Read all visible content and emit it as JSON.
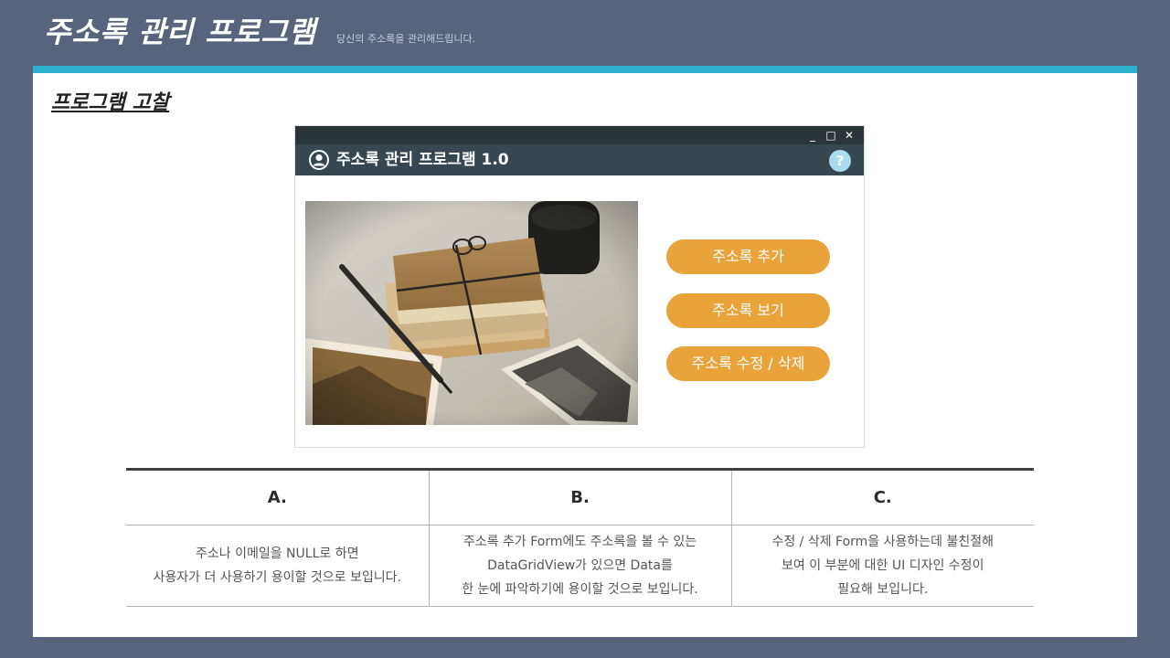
{
  "header": {
    "title": "주소록 관리 프로그램",
    "subtitle": "당신의 주소록을 관리해드립니다."
  },
  "section": {
    "heading": "프로그램 고찰"
  },
  "window": {
    "controls": {
      "minimize": "_",
      "maximize": "□",
      "close": "✕"
    },
    "app_title": "주소록 관리 프로그램 1.0",
    "help": "?",
    "buttons": {
      "add": "주소록 추가",
      "view": "주소록 보기",
      "edit": "주소록 수정 / 삭제"
    }
  },
  "review": {
    "headers": [
      "A.",
      "B.",
      "C."
    ],
    "cells": [
      [
        "주소나 이메일을 NULL로 하면",
        "사용자가 더 사용하기 용이할 것으로 보입니다."
      ],
      [
        "주소록 추가 Form에도 주소록을 볼 수 있는",
        "DataGridView가 있으면 Data를",
        "한 눈에 파악하기에 용이할 것으로 보입니다."
      ],
      [
        "수정 / 삭제 Form을 사용하는데 불친절해",
        "보여 이 부분에 대한 UI 디자인 수정이",
        "필요해 보입니다."
      ]
    ]
  },
  "colors": {
    "background": "#58647e",
    "accent": "#2eb0d0",
    "button": "#e8a33b",
    "window_title": "#37474f"
  }
}
